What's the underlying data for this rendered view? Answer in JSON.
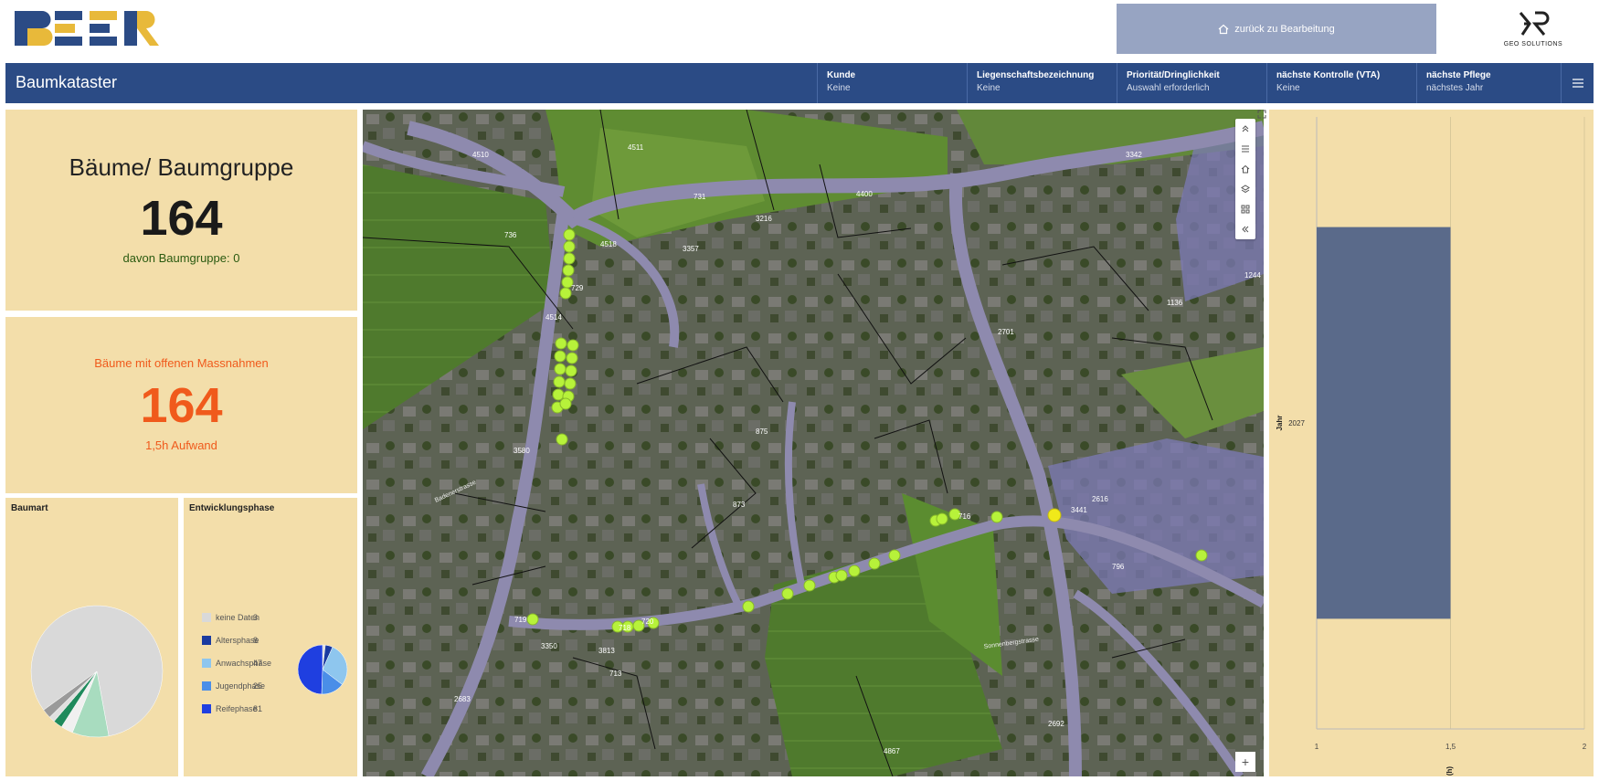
{
  "topbar": {
    "back_label": "zurück zu Bearbeitung"
  },
  "geo_logo": {
    "text": "GEO SOLUTIONS"
  },
  "header": {
    "title": "Baumkataster",
    "selectors": [
      {
        "label": "Kunde",
        "value": "Keine"
      },
      {
        "label": "Liegenschaftsbezeichnung",
        "value": "Keine"
      },
      {
        "label": "Priorität/Dringlichkeit",
        "value": "Auswahl erforderlich"
      },
      {
        "label": "nächste Kontrolle (VTA)",
        "value": "Keine"
      },
      {
        "label": "nächste Pflege",
        "value": "nächstes Jahr"
      }
    ]
  },
  "trees_card": {
    "title": "Bäume/ Baumgruppe",
    "count": "164",
    "subtitle": "davon Baumgruppe: 0"
  },
  "measures_card": {
    "title": "Bäume mit offenen Massnahmen",
    "count": "164",
    "subtitle": "1,5h Aufwand"
  },
  "baumart": {
    "title": "Baumart",
    "slices": [
      {
        "value": 110,
        "color": "#d9d9d9"
      },
      {
        "value": 12,
        "color": "#a8dcbf"
      },
      {
        "value": 4,
        "color": "#f0f0f0"
      },
      {
        "value": 3,
        "color": "#1f8a5c"
      },
      {
        "value": 2,
        "color": "#e0e0e0"
      },
      {
        "value": 3,
        "color": "#9a9a9a"
      }
    ]
  },
  "entwicklungsphase": {
    "title": "Entwicklungsphase",
    "items": [
      {
        "label": "keine Daten",
        "value": 3,
        "color": "#d9d9d9"
      },
      {
        "label": "Altersphase",
        "value": 8,
        "color": "#1a3aa0"
      },
      {
        "label": "Anwachsphase",
        "value": 47,
        "color": "#8ec6ee"
      },
      {
        "label": "Jugendphase",
        "value": 25,
        "color": "#4a8ee8"
      },
      {
        "label": "Reifephase",
        "value": 81,
        "color": "#1f3fe0"
      }
    ]
  },
  "map": {
    "parcel_labels": [
      "4510",
      "4511",
      "731",
      "736",
      "4518",
      "729",
      "4514",
      "3357",
      "3216",
      "4400",
      "3342",
      "2701",
      "1136",
      "1244",
      "875",
      "873",
      "716",
      "3441",
      "2616",
      "796",
      "718",
      "720",
      "3580",
      "719",
      "2683",
      "2692",
      "4867",
      "713",
      "3350",
      "3813"
    ],
    "street_labels": [
      "Sonnenbergstrasse",
      "Badenerstrasse"
    ]
  },
  "bar_chart": {
    "chart_data": {
      "type": "bar",
      "orientation": "horizontal",
      "categories": [
        "2027"
      ],
      "values": [
        1.5
      ],
      "xlim": [
        1,
        2
      ],
      "xticks": [
        "1",
        "1,5",
        "2"
      ],
      "ylabel": "Jahr",
      "xlabel": "Aufwand (h)",
      "bar_color": "#5a6a8a"
    }
  },
  "colors": {
    "header_blue": "#2b4b85",
    "panel_beige": "#f3deaa",
    "tree_point": "#b7f23a",
    "tree_point_selected": "#f0e91a",
    "accent_orange": "#f05a1c"
  }
}
